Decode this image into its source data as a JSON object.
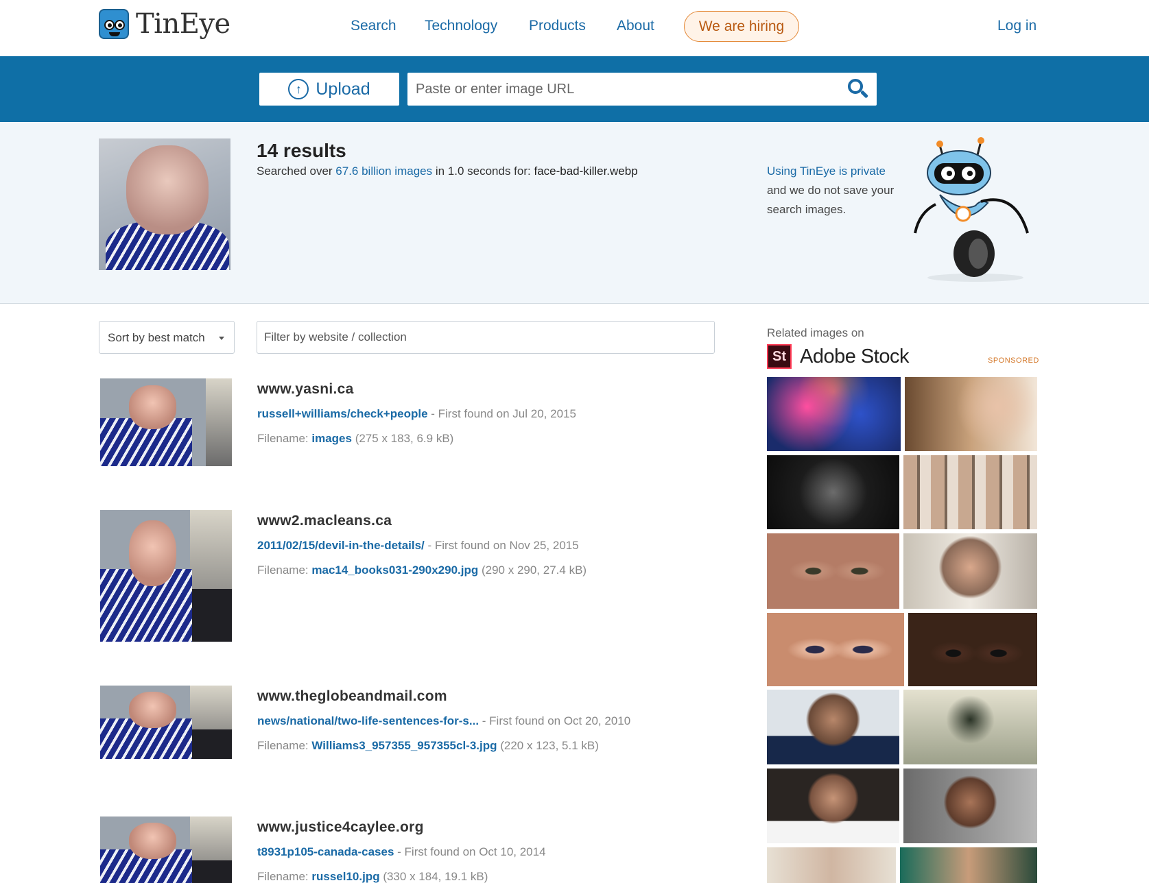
{
  "header": {
    "logo_text": "TinEye",
    "nav": [
      "Search",
      "Technology",
      "Products",
      "About"
    ],
    "hiring_label": "We are hiring",
    "login_label": "Log in"
  },
  "search": {
    "upload_label": "Upload",
    "url_placeholder": "Paste or enter image URL"
  },
  "summary": {
    "count_text": "14 results",
    "searched_prefix": "Searched over ",
    "searched_link": "67.6 billion images",
    "searched_mid": " in 1.0 seconds for: ",
    "filename": "face-bad-killer.webp",
    "private_link": "Using TinEye is private",
    "private_text": "and we do not save your search images."
  },
  "filters": {
    "sort_label": "Sort by best match",
    "filter_placeholder": "Filter by website / collection"
  },
  "results": [
    {
      "domain": "www.yasni.ca",
      "path": "russell+williams/check+people",
      "found": " - First found on Jul 20, 2015",
      "filename_label": "Filename: ",
      "filename": "images",
      "meta": " (275 x 183, 6.9 kB)"
    },
    {
      "domain": "www2.macleans.ca",
      "path": "2011/02/15/devil-in-the-details/",
      "found": " - First found on Nov 25, 2015",
      "filename_label": "Filename: ",
      "filename": "mac14_books031-290x290.jpg",
      "meta": " (290 x 290, 27.4 kB)"
    },
    {
      "domain": "www.theglobeandmail.com",
      "path": "news/national/two-life-sentences-for-s...",
      "found": "  - First found on Oct 20, 2010",
      "filename_label": "Filename: ",
      "filename": "Williams3_957355_957355cl-3.jpg",
      "meta": " (220 x 123, 5.1 kB)"
    },
    {
      "domain": "www.justice4caylee.org",
      "path": "t8931p105-canada-cases",
      "found": " - First found on Oct 10, 2014",
      "filename_label": "Filename: ",
      "filename": "russel10.jpg",
      "meta": " (330 x 184, 19.1 kB)"
    }
  ],
  "sidebar": {
    "related_label": "Related images on",
    "brand_logo": "St",
    "brand_name": "Adobe Stock",
    "sponsored": "SPONSORED"
  },
  "colors": {
    "link": "#1a6aa6",
    "band": "#0f6fa6",
    "hiring": "#e48a3a",
    "summary_bg": "#f1f6fa"
  }
}
